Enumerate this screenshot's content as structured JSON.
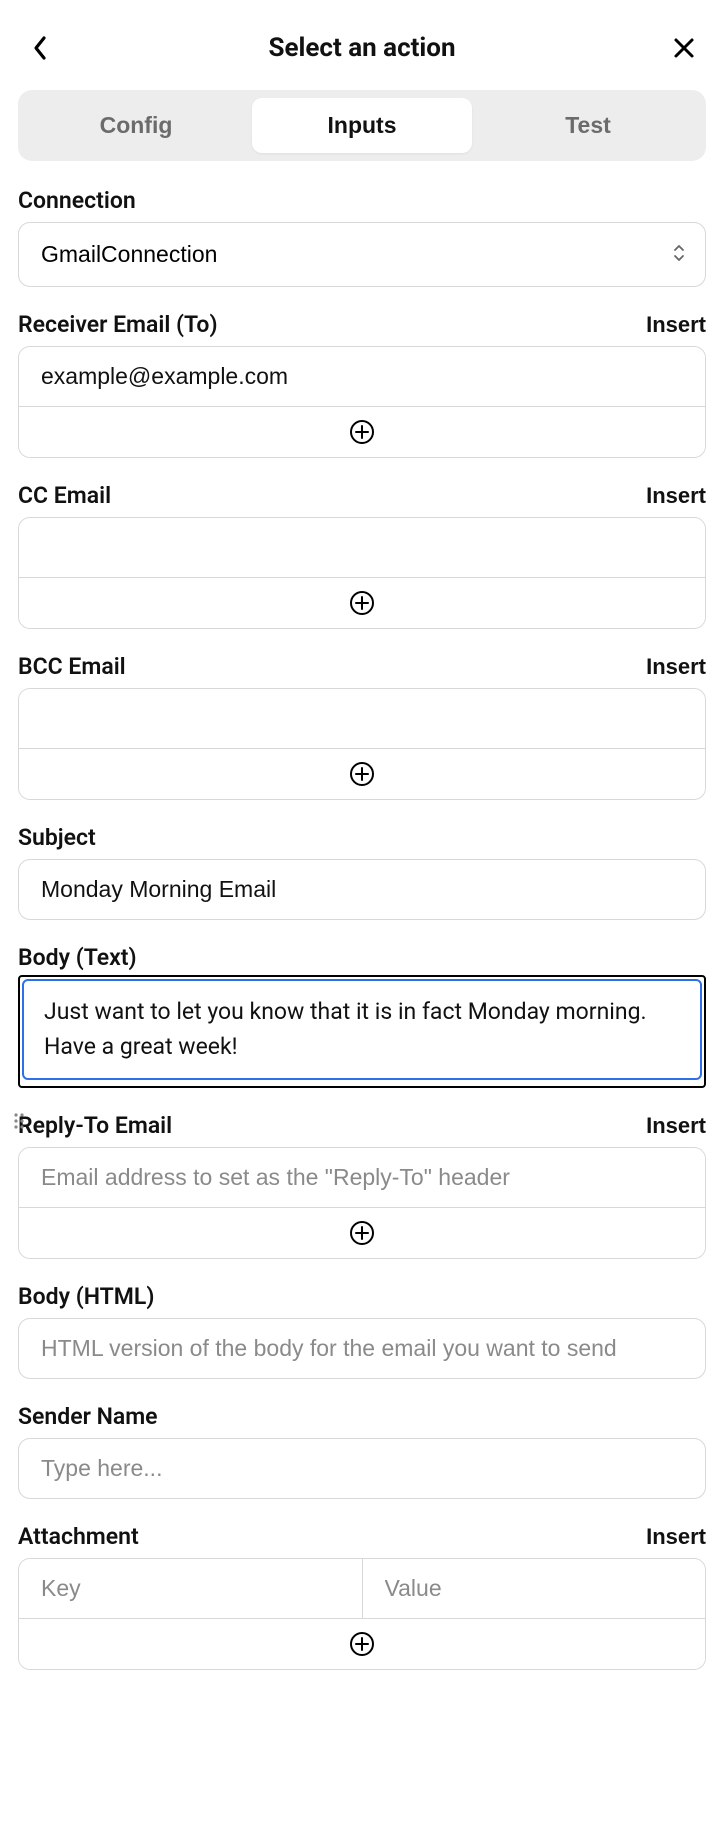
{
  "header": {
    "title": "Select an action"
  },
  "tabs": {
    "config": "Config",
    "inputs": "Inputs",
    "test": "Test"
  },
  "insert_label": "Insert",
  "connection": {
    "label": "Connection",
    "value": "GmailConnection"
  },
  "receiver": {
    "label": "Receiver Email (To)",
    "value": "example@example.com"
  },
  "cc": {
    "label": "CC Email",
    "value": ""
  },
  "bcc": {
    "label": "BCC Email",
    "value": ""
  },
  "subject": {
    "label": "Subject",
    "value": "Monday Morning Email"
  },
  "body_text": {
    "label": "Body (Text)",
    "value": "Just want to let you know that it is in fact Monday morning. Have a great week!"
  },
  "reply_to": {
    "label": "Reply-To Email",
    "placeholder": "Email address to set as the \"Reply-To\" header",
    "value": ""
  },
  "body_html": {
    "label": "Body (HTML)",
    "placeholder": "HTML version of the body for the email you want to send",
    "value": ""
  },
  "sender_name": {
    "label": "Sender Name",
    "placeholder": "Type here...",
    "value": ""
  },
  "attachment": {
    "label": "Attachment",
    "key_placeholder": "Key",
    "value_placeholder": "Value"
  }
}
